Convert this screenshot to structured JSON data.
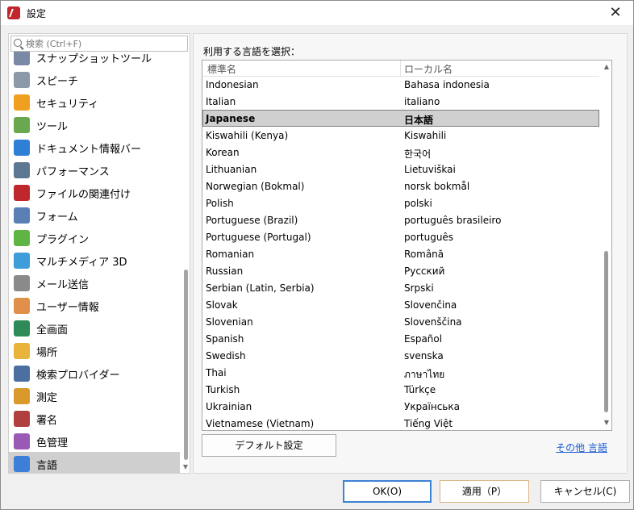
{
  "window": {
    "title": "設定",
    "close_glyph": "✕"
  },
  "sidebar": {
    "search_placeholder": "検索 (Ctrl+F)",
    "items": [
      {
        "label": "スナップショットツール",
        "icon": "snapshot-icon",
        "color": "#7a8aa6"
      },
      {
        "label": "スピーチ",
        "icon": "speaker-icon",
        "color": "#8a98a8"
      },
      {
        "label": "セキュリティ",
        "icon": "shield-icon",
        "color": "#f0a020"
      },
      {
        "label": "ツール",
        "icon": "tools-icon",
        "color": "#6aa84f"
      },
      {
        "label": "ドキュメント情報バー",
        "icon": "info-icon",
        "color": "#2f7fd6"
      },
      {
        "label": "パフォーマンス",
        "icon": "gauge-icon",
        "color": "#5d7691"
      },
      {
        "label": "ファイルの関連付け",
        "icon": "pdf-file-icon",
        "color": "#c0272d"
      },
      {
        "label": "フォーム",
        "icon": "form-icon",
        "color": "#5a7fb5"
      },
      {
        "label": "プラグイン",
        "icon": "puzzle-icon",
        "color": "#5fb544"
      },
      {
        "label": "マルチメディア 3D",
        "icon": "cube-icon",
        "color": "#3d9ed9"
      },
      {
        "label": "メール送信",
        "icon": "mail-icon",
        "color": "#8a8a8a"
      },
      {
        "label": "ユーザー情報",
        "icon": "user-icon",
        "color": "#e0904a"
      },
      {
        "label": "全画面",
        "icon": "fullscreen-icon",
        "color": "#2e8b57"
      },
      {
        "label": "場所",
        "icon": "folder-icon",
        "color": "#e8b53a"
      },
      {
        "label": "検索プロバイダー",
        "icon": "binoculars-icon",
        "color": "#4a6fa0"
      },
      {
        "label": "測定",
        "icon": "ruler-icon",
        "color": "#d99a2b"
      },
      {
        "label": "署名",
        "icon": "signature-icon",
        "color": "#b04040"
      },
      {
        "label": "色管理",
        "icon": "color-wheel-icon",
        "color": "#9b59b6"
      },
      {
        "label": "言語",
        "icon": "language-icon",
        "color": "#3d7fd6"
      }
    ],
    "active_index": 18
  },
  "panel": {
    "section_label": "利用する言語を選択：",
    "columns": {
      "standard": "標準名",
      "local": "ローカル名"
    },
    "rows": [
      {
        "standard": "Indonesian",
        "local": "Bahasa indonesia"
      },
      {
        "standard": "Italian",
        "local": "italiano"
      },
      {
        "standard": "Japanese",
        "local": "日本語"
      },
      {
        "standard": "Kiswahili (Kenya)",
        "local": "Kiswahili"
      },
      {
        "standard": "Korean",
        "local": "한국어"
      },
      {
        "standard": "Lithuanian",
        "local": "Lietuviškai"
      },
      {
        "standard": "Norwegian (Bokmal)",
        "local": "norsk bokmål"
      },
      {
        "standard": "Polish",
        "local": "polski"
      },
      {
        "standard": "Portuguese (Brazil)",
        "local": "português brasileiro"
      },
      {
        "standard": "Portuguese (Portugal)",
        "local": "português"
      },
      {
        "standard": "Romanian",
        "local": "Română"
      },
      {
        "standard": "Russian",
        "local": "Русский"
      },
      {
        "standard": "Serbian (Latin, Serbia)",
        "local": "Srpski"
      },
      {
        "standard": "Slovak",
        "local": "Slovenčina"
      },
      {
        "standard": "Slovenian",
        "local": "Slovenščina"
      },
      {
        "standard": "Spanish",
        "local": "Español"
      },
      {
        "standard": "Swedish",
        "local": "svenska"
      },
      {
        "standard": "Thai",
        "local": "ภาษาไทย"
      },
      {
        "standard": "Turkish",
        "local": "Türkçe"
      },
      {
        "standard": "Ukrainian",
        "local": "Українська"
      },
      {
        "standard": "Vietnamese (Vietnam)",
        "local": "Tiếng Việt"
      }
    ],
    "selected_index": 2,
    "default_button": "デフォルト設定",
    "other_languages_link": "その他 言語"
  },
  "footer": {
    "ok": "OK(O)",
    "apply": "適用（P）",
    "cancel": "キャンセル(C)"
  }
}
